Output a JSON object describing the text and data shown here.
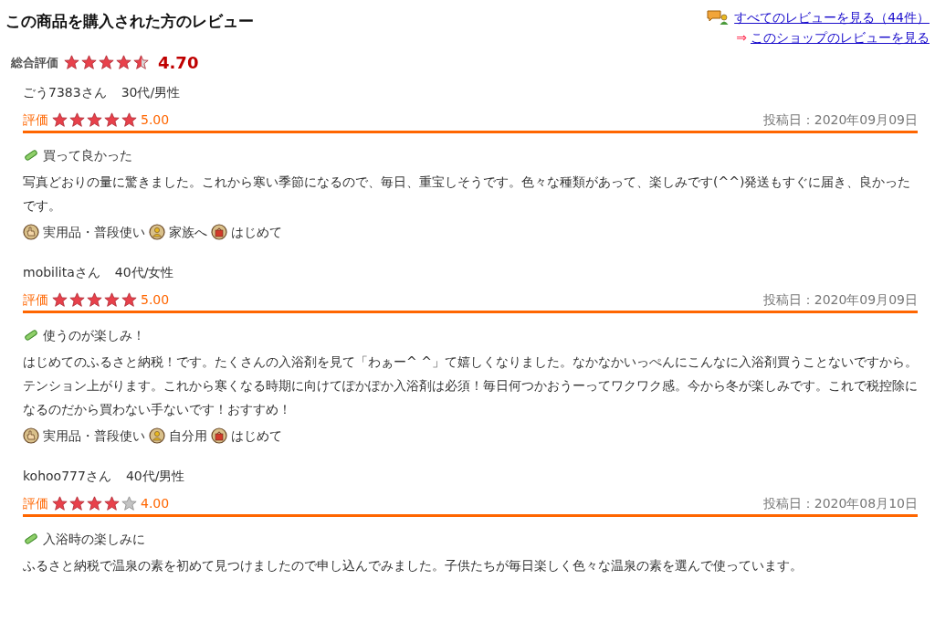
{
  "title": "この商品を購入された方のレビュー",
  "links": [
    {
      "kind": "all",
      "text": "すべてのレビューを見る（44件）"
    },
    {
      "kind": "shop",
      "arrow": "⇒",
      "text": "このショップのレビューを見る"
    }
  ],
  "overall": {
    "label": "総合評価",
    "stars": 4.5,
    "score": "4.70"
  },
  "reviews": [
    {
      "author": "ごう7383さん",
      "demographic": "30代/男性",
      "rating_label": "評価",
      "stars": 5,
      "score": "5.00",
      "date": "投稿日：2020年09月09日",
      "headline": "買って良かった",
      "body": "写真どおりの量に驚きました。これから寒い季節になるので、毎日、重宝しそうです。色々な種類があって、楽しみです(^^)発送もすぐに届き、良かったです。",
      "tags": [
        {
          "kind": "purpose",
          "text": "実用品・普段使い"
        },
        {
          "kind": "recipient",
          "text": "家族へ"
        },
        {
          "kind": "frequency",
          "text": "はじめて"
        }
      ]
    },
    {
      "author": "mobilitaさん",
      "demographic": "40代/女性",
      "rating_label": "評価",
      "stars": 5,
      "score": "5.00",
      "date": "投稿日：2020年09月09日",
      "headline": "使うのが楽しみ！",
      "body": "はじめてのふるさと納税！です。たくさんの入浴剤を見て「わぁー^ ^」て嬉しくなりました。なかなかいっぺんにこんなに入浴剤買うことないですから。テンション上がります。これから寒くなる時期に向けてぽかぽか入浴剤は必須！毎日何つかおうーってワクワク感。今から冬が楽しみです。これで税控除になるのだから買わない手ないです！おすすめ！",
      "tags": [
        {
          "kind": "purpose",
          "text": "実用品・普段使い"
        },
        {
          "kind": "recipient",
          "text": "自分用"
        },
        {
          "kind": "frequency",
          "text": "はじめて"
        }
      ]
    },
    {
      "author": "kohoo777さん",
      "demographic": "40代/男性",
      "rating_label": "評価",
      "stars": 4,
      "score": "4.00",
      "date": "投稿日：2020年08月10日",
      "headline": "入浴時の楽しみに",
      "body": "ふるさと納税で温泉の素を初めて見つけましたので申し込んでみました。子供たちが毎日楽しく色々な温泉の素を選んで使っています。"
    }
  ]
}
